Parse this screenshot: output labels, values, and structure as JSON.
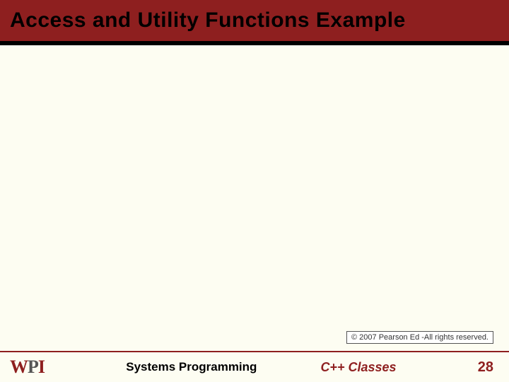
{
  "slide": {
    "title": "Access and Utility Functions Example"
  },
  "copyright": "© 2007 Pearson Ed -All rights reserved.",
  "footer": {
    "logo": {
      "w": "W",
      "p": "P",
      "i": "I"
    },
    "course": "Systems Programming",
    "topic": "C++ Classes",
    "page": "28"
  }
}
